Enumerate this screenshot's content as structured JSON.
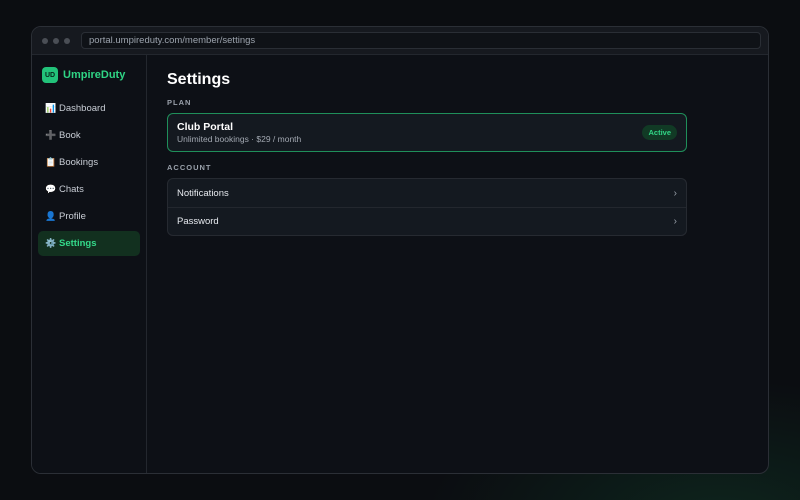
{
  "browser": {
    "url": "portal.umpireduty.com/member/settings"
  },
  "brand": {
    "logo_text": "UD",
    "name": "UmpireDuty",
    "color": "#22c27a"
  },
  "sidebar": {
    "items": [
      {
        "icon": "chart-icon",
        "glyph": "📊",
        "label": "Dashboard"
      },
      {
        "icon": "plus-icon",
        "glyph": "➕",
        "label": "Book"
      },
      {
        "icon": "clipboard-icon",
        "glyph": "📋",
        "label": "Bookings"
      },
      {
        "icon": "chat-bubble-icon",
        "glyph": "💬",
        "label": "Chats"
      },
      {
        "icon": "user-icon",
        "glyph": "👤",
        "label": "Profile"
      },
      {
        "icon": "gear-icon",
        "glyph": "⚙️",
        "label": "Settings",
        "active": true
      }
    ]
  },
  "main": {
    "title": "Settings",
    "plan_section": {
      "label": "PLAN",
      "plan_name": "Club Portal",
      "plan_desc": "Unlimited bookings · $29 / month",
      "status": "Active",
      "accent": "#1f8f5a"
    },
    "account_section": {
      "label": "ACCOUNT",
      "rows": [
        {
          "label": "Notifications",
          "chevron": "›"
        },
        {
          "label": "Password",
          "chevron": "›"
        }
      ]
    }
  }
}
